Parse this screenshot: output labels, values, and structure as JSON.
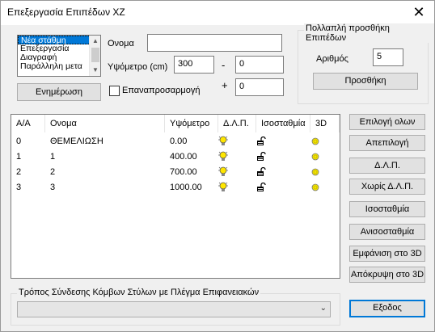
{
  "window": {
    "title": "Επεξεργασία Επιπέδων XZ",
    "close_glyph": "✕"
  },
  "levels_list": {
    "items": [
      "Νέα στάθμη",
      "Επεξεργασία",
      "Διαγραφή",
      "Παράλληλη μετα"
    ],
    "selected": 0
  },
  "update_button": "Ενημέρωση",
  "name_label": "Ονομα",
  "name_value": "",
  "elevation_label": "Υψόμετρο (cm)",
  "elevation_value": "300",
  "minus_sign": "-",
  "plus_sign": "+",
  "minus_value": "0",
  "plus_value": "0",
  "reapply_label": "Επαναπροσαρμογή",
  "reapply_checked": false,
  "multi_add": {
    "title": "Πολλαπλή προσθήκη Επιπέδων",
    "count_label": "Αριθμός",
    "count_value": "5",
    "add_button": "Προσθήκη"
  },
  "table": {
    "columns": [
      "Α/Α",
      "Ονομα",
      "Υψόμετρο",
      "Δ.Λ.Π.",
      "Ισοσταθμία",
      "3D"
    ],
    "rows": [
      {
        "id": "0",
        "name": "ΘΕΜΕΛΙΩΣΗ",
        "elevation": "0.00"
      },
      {
        "id": "1",
        "name": "1",
        "elevation": "400.00"
      },
      {
        "id": "2",
        "name": "2",
        "elevation": "700.00"
      },
      {
        "id": "3",
        "name": "3",
        "elevation": "1000.00"
      }
    ],
    "icons": {
      "dlp": "lightbulb-icon",
      "iso": "lock-open-icon",
      "three_d": "sun-icon"
    }
  },
  "side_buttons": {
    "select_all": "Επιλογή ολων",
    "deselect": "Απεπιλογή",
    "dlp": "Δ.Λ.Π.",
    "no_dlp": "Χωρίς Δ.Λ.Π.",
    "iso": "Ισοσταθμία",
    "aniso": "Ανισοσταθμία",
    "show_3d": "Εμφάνιση στο 3D",
    "hide_3d": "Απόκρυψη στο 3D"
  },
  "connection_group": {
    "title": "Τρόπος Σύνδεσης Κόμβων Στύλων με Πλέγμα Επιφανειακών",
    "combo_value": ""
  },
  "exit_button": "Εξοδος",
  "colors": {
    "selection": "#0078d7",
    "bulb": "#ffe600",
    "sun": "#f2e400",
    "default_border": "#0078d7"
  }
}
